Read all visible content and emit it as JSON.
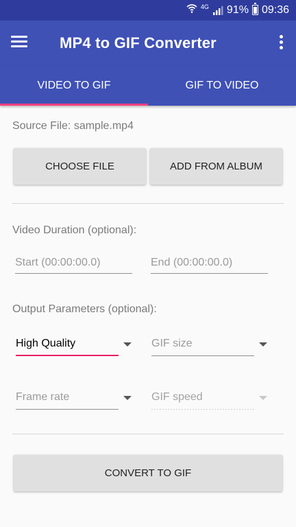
{
  "status_bar": {
    "network_type": "4G",
    "battery_percent": "91%",
    "time": "09:36"
  },
  "app_bar": {
    "title": "MP4 to GIF Converter"
  },
  "tabs": [
    {
      "label": "VIDEO TO GIF",
      "active": true
    },
    {
      "label": "GIF TO VIDEO",
      "active": false
    }
  ],
  "source": {
    "label": "Source File: sample.mp4"
  },
  "buttons": {
    "choose_file": "CHOOSE FILE",
    "add_from_album": "ADD FROM ALBUM",
    "convert": "CONVERT TO GIF"
  },
  "duration": {
    "label": "Video Duration (optional):",
    "start_placeholder": "Start (00:00:00.0)",
    "end_placeholder": "End (00:00:00.0)"
  },
  "output": {
    "label": "Output Parameters (optional):",
    "quality": "High Quality",
    "gif_size": "GIF size",
    "frame_rate": "Frame rate",
    "gif_speed": "GIF speed"
  },
  "colors": {
    "primary": "#3f51b5",
    "primary_dark": "#2f3c9e",
    "accent": "#ff4081"
  }
}
